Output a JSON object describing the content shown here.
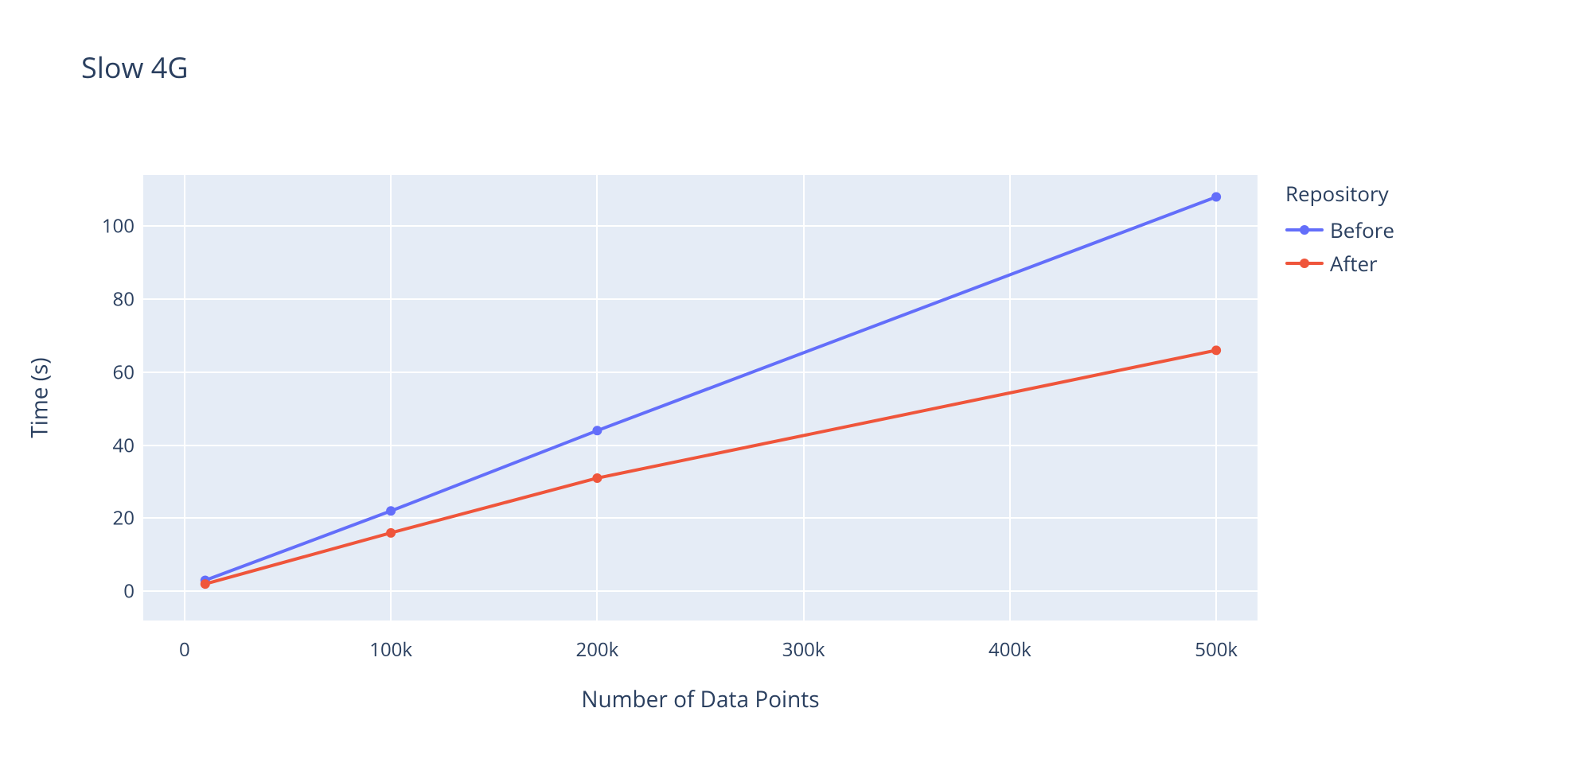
{
  "title": "Slow 4G",
  "xlabel": "Number of Data Points",
  "ylabel": "Time (s)",
  "legend_title": "Repository",
  "legend": {
    "before": "Before",
    "after": "After"
  },
  "colors": {
    "before": "#636efa",
    "after": "#ef553b"
  },
  "yticks": [
    "0",
    "20",
    "40",
    "60",
    "80",
    "100"
  ],
  "xticks": [
    "0",
    "100k",
    "200k",
    "300k",
    "400k",
    "500k"
  ],
  "chart_data": {
    "type": "line",
    "title": "Slow 4G",
    "xlabel": "Number of Data Points",
    "ylabel": "Time (s)",
    "xlim": [
      -20000,
      520000
    ],
    "ylim": [
      -8,
      114
    ],
    "x": [
      10000,
      100000,
      200000,
      500000
    ],
    "series": [
      {
        "name": "Before",
        "values": [
          3,
          22,
          44,
          108
        ]
      },
      {
        "name": "After",
        "values": [
          2,
          16,
          31,
          66
        ]
      }
    ],
    "xtick_values": [
      0,
      100000,
      200000,
      300000,
      400000,
      500000
    ],
    "ytick_values": [
      0,
      20,
      40,
      60,
      80,
      100
    ],
    "legend_title": "Repository",
    "legend_position": "right",
    "grid": true
  }
}
